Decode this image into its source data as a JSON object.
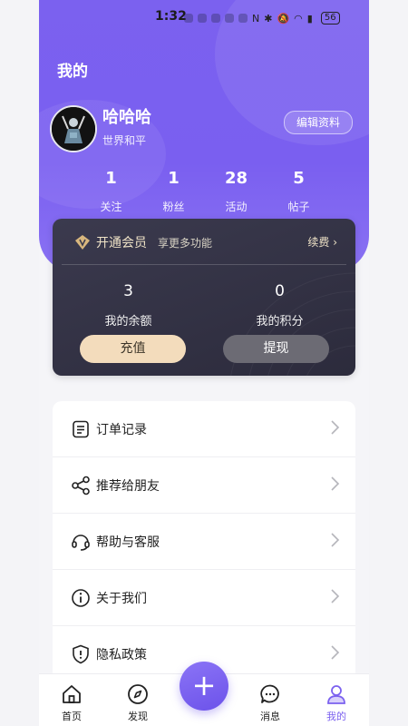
{
  "status_bar": {
    "time": "1:32",
    "battery": "56"
  },
  "header": {
    "title": "我的"
  },
  "profile": {
    "name": "哈哈哈",
    "bio": "世界和平",
    "edit_label": "编辑资料"
  },
  "stats": [
    {
      "value": "1",
      "label": "关注"
    },
    {
      "value": "1",
      "label": "粉丝"
    },
    {
      "value": "28",
      "label": "活动"
    },
    {
      "value": "5",
      "label": "帖子"
    }
  ],
  "vip": {
    "title": "开通会员",
    "subtitle": "享更多功能",
    "renew_label": "续费",
    "balance": {
      "value": "3",
      "label": "我的余额"
    },
    "points": {
      "value": "0",
      "label": "我的积分"
    },
    "recharge_label": "充值",
    "withdraw_label": "提现"
  },
  "menu": [
    {
      "label": "订单记录",
      "icon": "order-list-icon"
    },
    {
      "label": "推荐给朋友",
      "icon": "share-icon"
    },
    {
      "label": "帮助与客服",
      "icon": "customer-service-icon"
    },
    {
      "label": "关于我们",
      "icon": "info-icon"
    },
    {
      "label": "隐私政策",
      "icon": "shield-icon"
    }
  ],
  "tabbar": [
    {
      "label": "首页",
      "icon": "home-icon"
    },
    {
      "label": "发现",
      "icon": "compass-icon"
    },
    {
      "label": "消息",
      "icon": "chat-icon"
    },
    {
      "label": "我的",
      "icon": "user-icon",
      "active": true
    }
  ],
  "fab": {
    "symbol": "+"
  },
  "colors": {
    "accent": "#7b61ef",
    "vip_gold": "#efe3c7",
    "card_dark": "#2f2e40"
  }
}
